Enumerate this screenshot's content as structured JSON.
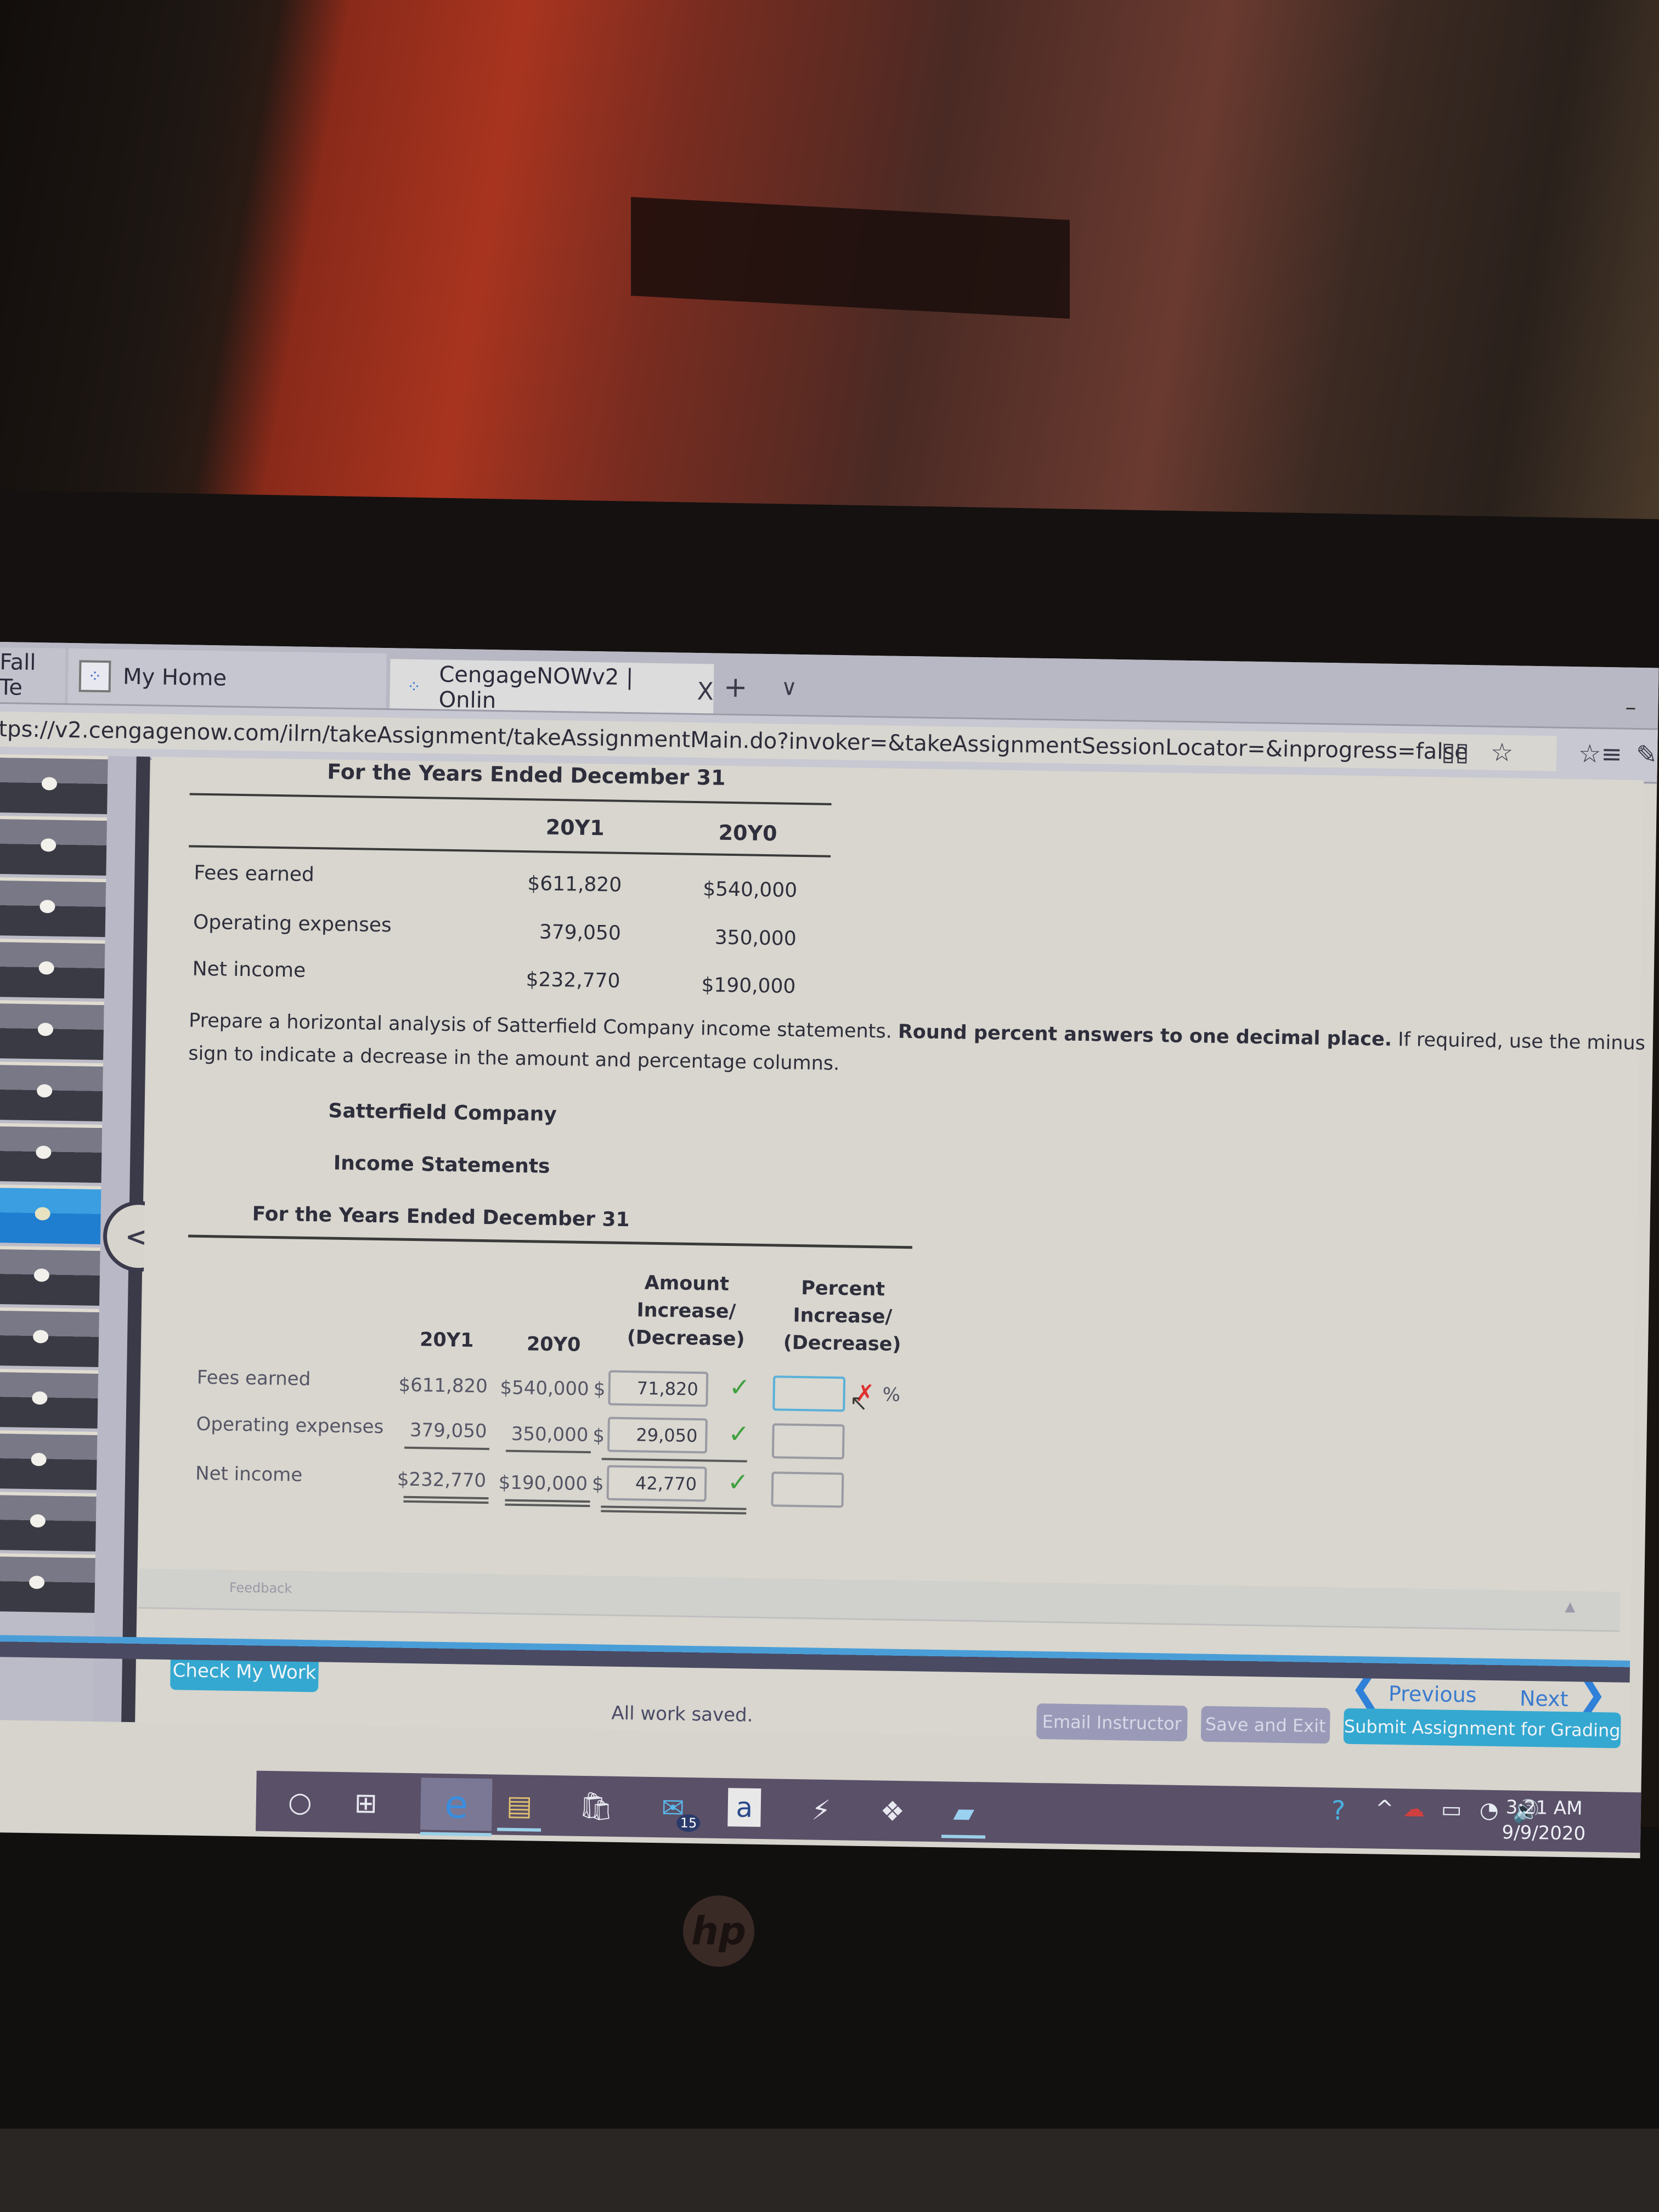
{
  "browser": {
    "tabs": [
      {
        "label": "Fall Te",
        "active": false
      },
      {
        "label": "My Home",
        "active": false
      },
      {
        "label": "CengageNOWv2 | Onlin",
        "active": true
      }
    ],
    "new_tab": "+",
    "tab_list": "∨",
    "close_glyph": "X",
    "url": "tps://v2.cengagenow.com/ilrn/takeAssignment/takeAssignmentMain.do?invoker=&takeAssignmentSessionLocator=&inprogress=false",
    "icons": {
      "reading": "▯▯",
      "favorite": "☆",
      "favorites_list": "☆≡",
      "notes": "✎"
    }
  },
  "sidebar": {
    "question_count": 14,
    "active_index": 7,
    "collapse_glyph": "<"
  },
  "given_statement": {
    "period": "For the Years Ended December 31",
    "col_headers": [
      "20Y1",
      "20Y0"
    ],
    "rows": [
      {
        "label": "Fees earned",
        "y1": "$611,820",
        "y0": "$540,000"
      },
      {
        "label": "Operating expenses",
        "y1": "379,050",
        "y0": "350,000"
      },
      {
        "label": "Net income",
        "y1": "$232,770",
        "y0": "$190,000"
      }
    ]
  },
  "instructions": {
    "line1_plain": "Prepare a horizontal analysis of Satterfield Company income statements. ",
    "line1_bold": "Round percent answers to one decimal place.",
    "line1_tail": " If required, use the minus",
    "line2": "sign to indicate a decrease in the amount and percentage columns."
  },
  "analysis": {
    "company": "Satterfield Company",
    "statement": "Income Statements",
    "period": "For the Years Ended December 31",
    "headers": {
      "y1": "20Y1",
      "y0": "20Y0",
      "amount": [
        "Amount",
        "Increase/",
        "(Decrease)"
      ],
      "percent": [
        "Percent",
        "Increase/",
        "(Decrease)"
      ]
    },
    "currency": "$",
    "percent_sign": "%",
    "rows": [
      {
        "label": "Fees earned",
        "y1": "$611,820",
        "y0": "$540,000",
        "amount": "71,820",
        "amount_status": "correct",
        "percent": "",
        "percent_status": "incorrect",
        "focused": true
      },
      {
        "label": "Operating expenses",
        "y1": "379,050",
        "y0": "350,000",
        "amount": "29,050",
        "amount_status": "correct",
        "percent": "",
        "percent_status": "",
        "focused": false
      },
      {
        "label": "Net income",
        "y1": "$232,770",
        "y0": "$190,000",
        "amount": "42,770",
        "amount_status": "correct",
        "percent": "",
        "percent_status": "",
        "focused": false
      }
    ],
    "check_glyph": "✓",
    "x_glyph": "✗"
  },
  "feedback": {
    "label": "Feedback"
  },
  "actions": {
    "check_my_work": "Check My Work",
    "previous": "Previous",
    "next": "Next",
    "status": "All work saved.",
    "email_instructor": "Email Instructor",
    "save_and_exit": "Save and Exit",
    "submit": "Submit Assignment for Grading"
  },
  "taskbar": {
    "apps": [
      "cortana",
      "task-view",
      "edge",
      "file-explorer",
      "store",
      "mail",
      "amazon",
      "winamp",
      "dropbox",
      "notes"
    ],
    "mail_badge": "15",
    "clock_time": "3:21 AM",
    "clock_date": "9/9/2020"
  },
  "colors": {
    "accent": "#34a8d0",
    "link": "#3a7ad0",
    "correct": "#3fa040",
    "incorrect": "#e03030",
    "focus": "#5ab0d8"
  },
  "device": {
    "logo": "hp"
  }
}
